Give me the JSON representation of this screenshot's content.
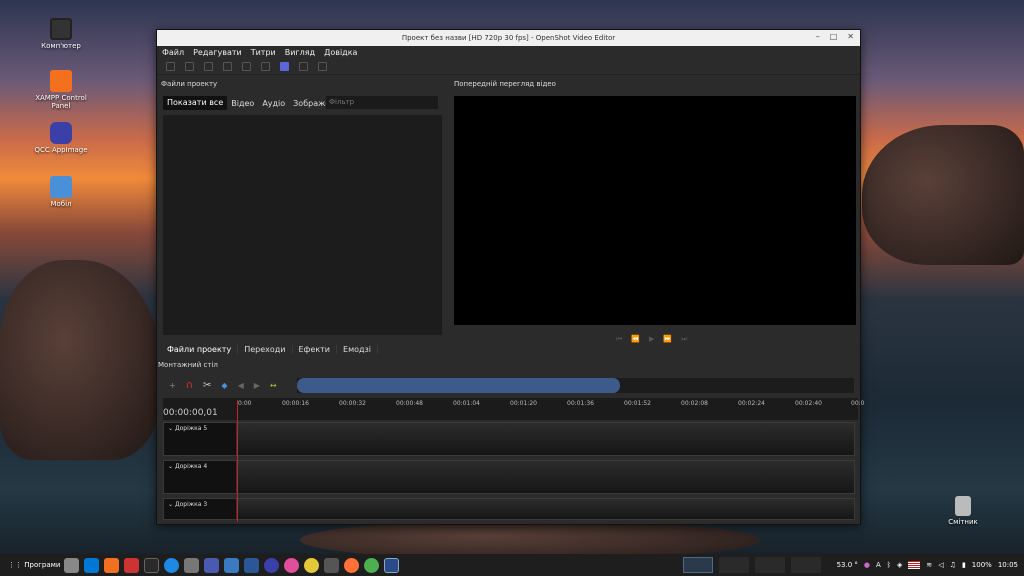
{
  "desktop": {
    "icons": [
      {
        "label": "Комп'ютер"
      },
      {
        "label": "XAMPP Control Panel"
      },
      {
        "label": "QCC AppImage"
      },
      {
        "label": "Мобіл"
      },
      {
        "label": "Смітник"
      }
    ]
  },
  "window": {
    "title": "Проект без назви [HD 720p 30 fps] - OpenShot Video Editor",
    "menu": [
      "Файл",
      "Редагувати",
      "Титри",
      "Вигляд",
      "Довідка"
    ]
  },
  "project_files": {
    "title": "Файли проекту",
    "tabs": [
      "Показати все",
      "Відео",
      "Аудіо",
      "Зображення"
    ],
    "filter_placeholder": "Фільтр",
    "bottom_tabs": [
      "Файли проекту",
      "Переходи",
      "Ефекти",
      "Емодзі"
    ]
  },
  "preview": {
    "title": "Попередній перегляд відео"
  },
  "timeline": {
    "title": "Монтажний стіл",
    "current_time": "00:00:00,01",
    "ticks": [
      "0:00",
      "00:00:16",
      "00:00:32",
      "00:00:48",
      "00:01:04",
      "00:01:20",
      "00:01:36",
      "00:01:52",
      "00:02:08",
      "00:02:24",
      "00:02:40",
      "00:0"
    ],
    "tracks": [
      "Доріжка 5",
      "Доріжка 4",
      "Доріжка 3"
    ]
  },
  "taskbar": {
    "start_label": "Програми",
    "temperature": "53.0 °",
    "battery": "100%",
    "clock": "10:05"
  },
  "colors": {
    "accent": "#5a67d8",
    "playhead": "#cc2222",
    "scroll_selection": "#3d5a8a"
  }
}
